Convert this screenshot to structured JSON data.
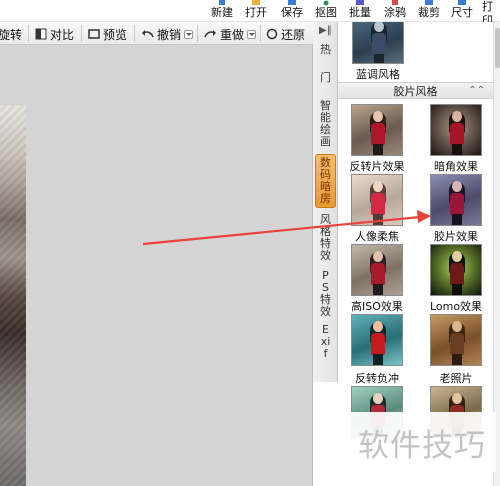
{
  "top_menu": {
    "items": [
      "新建",
      "打开",
      "保存",
      "抠图",
      "批量",
      "涂鸦",
      "裁剪",
      "尺寸",
      "打印"
    ]
  },
  "toolbar": {
    "rotate": "旋转",
    "contrast": "对比",
    "preview": "预览",
    "undo": "撤销",
    "redo": "重做",
    "restore": "还原"
  },
  "side_tabs": {
    "hot": "热",
    "door": "门",
    "smart": "智能绘画",
    "digital": "数码暗房",
    "style": "风格特效",
    "ps": "PS特效",
    "exif": "Exif",
    "active": "数码暗房"
  },
  "panel": {
    "top_item": "蓝调风格",
    "section_title": "胶片风格",
    "effects": [
      "反转片效果",
      "暗角效果",
      "人像柔焦",
      "胶片效果",
      "高ISO效果",
      "Lomo效果",
      "反转负冲",
      "老照片"
    ]
  },
  "colors": {
    "active_tab": "#e69a2f",
    "arrow": "#e8423a",
    "canvas": "#d4d4d4"
  },
  "watermark": "软件技巧"
}
